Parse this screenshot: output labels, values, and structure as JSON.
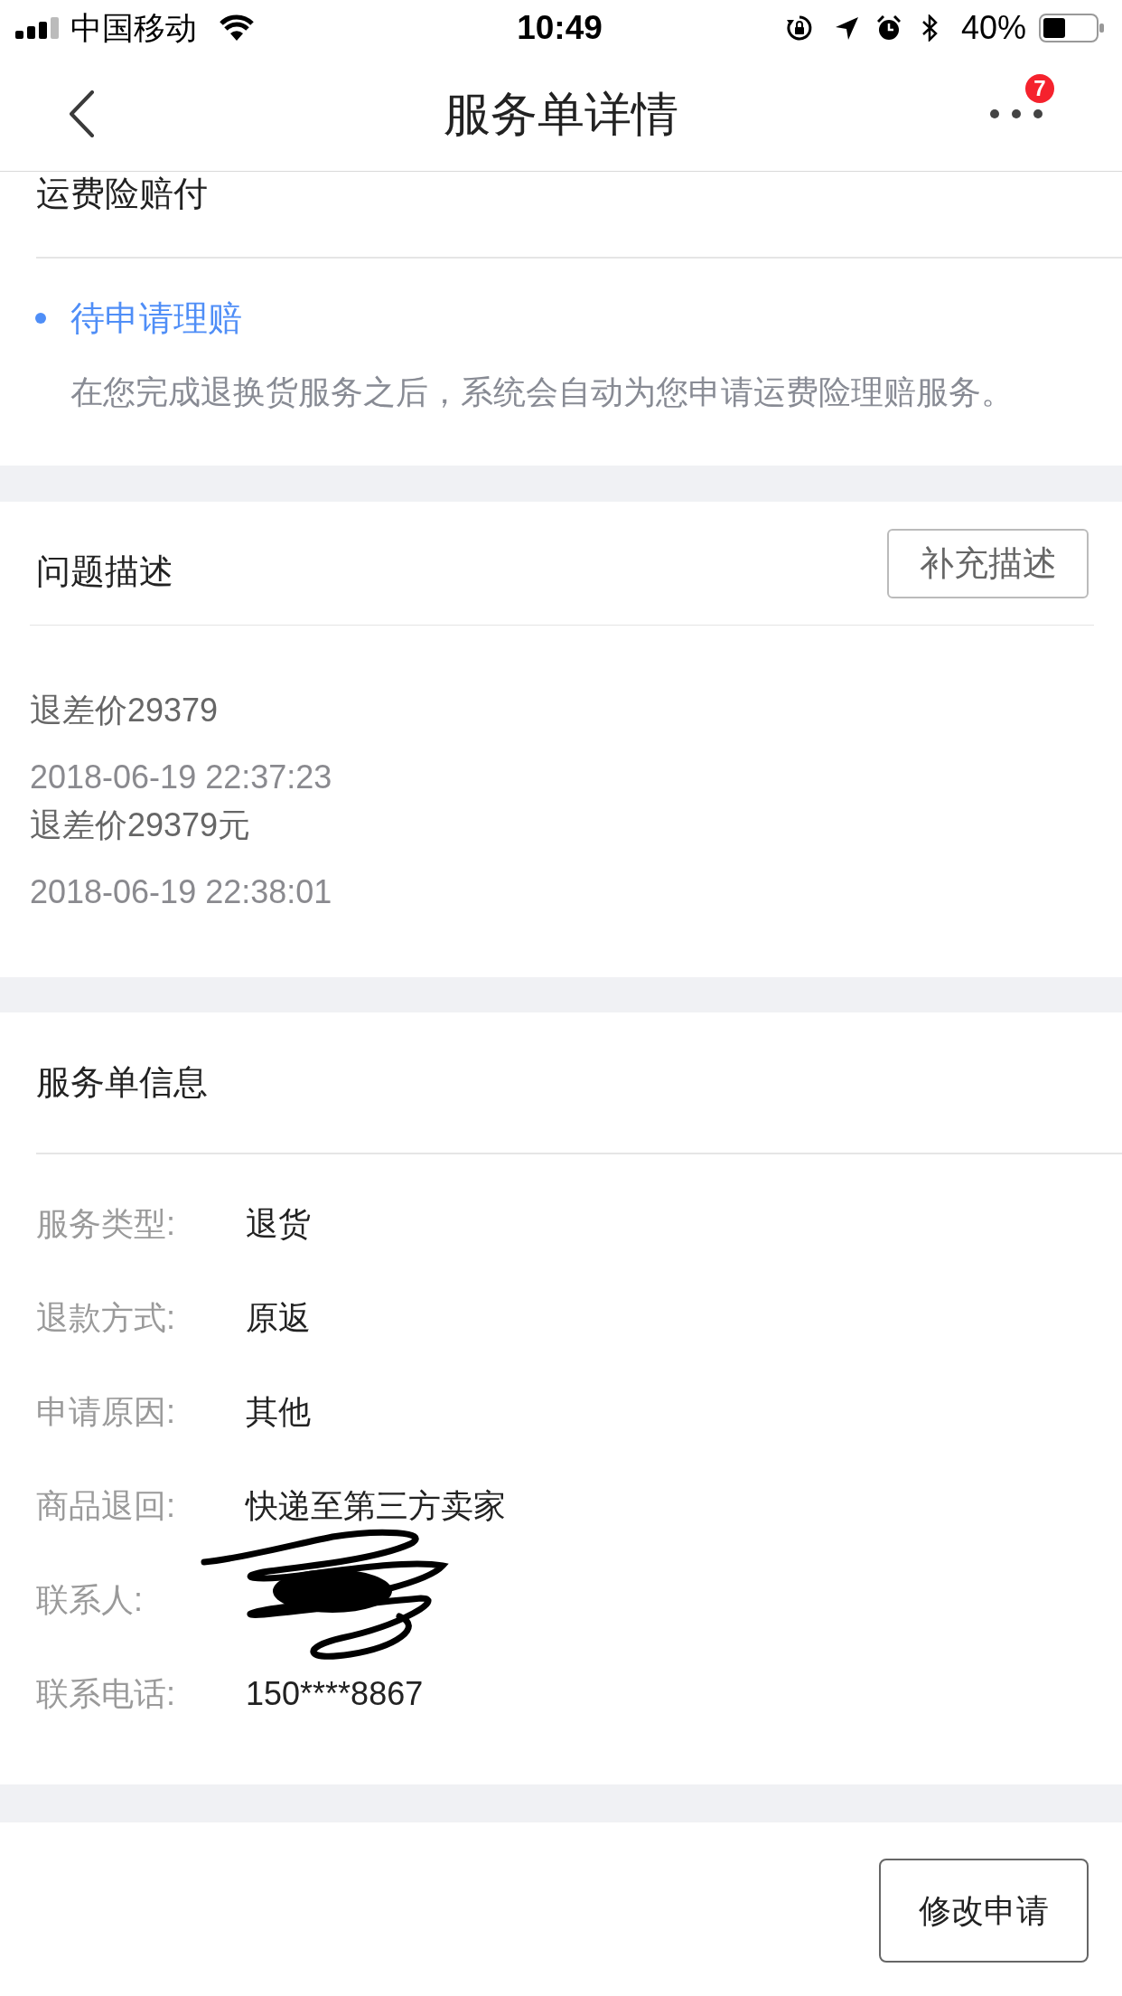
{
  "status_bar": {
    "carrier": "中国移动",
    "time": "10:49",
    "battery": "40%"
  },
  "nav_bar": {
    "title": "服务单详情",
    "badge": "7"
  },
  "freight_insurance": {
    "title": "运费险赔付",
    "status": "待申请理赔",
    "description": "在您完成退换货服务之后，系统会自动为您申请运费险理赔服务。"
  },
  "problem_description": {
    "title": "问题描述",
    "button": "补充描述",
    "entries": [
      {
        "text": "退差价29379",
        "time": "2018-06-19 22:37:23"
      },
      {
        "text": "退差价29379元",
        "time": "2018-06-19 22:38:01"
      }
    ]
  },
  "service_info": {
    "title": "服务单信息",
    "rows": [
      {
        "label": "服务类型:",
        "value": "退货",
        "redacted": false
      },
      {
        "label": "退款方式:",
        "value": "原返",
        "redacted": false
      },
      {
        "label": "申请原因:",
        "value": "其他",
        "redacted": false
      },
      {
        "label": "商品退回:",
        "value": "快递至第三方卖家",
        "redacted": false
      },
      {
        "label": "联系人:",
        "redacted": true
      },
      {
        "label": "联系电话:",
        "value": "150****8867",
        "redacted": false
      }
    ]
  },
  "footer": {
    "button": "修改申请"
  }
}
